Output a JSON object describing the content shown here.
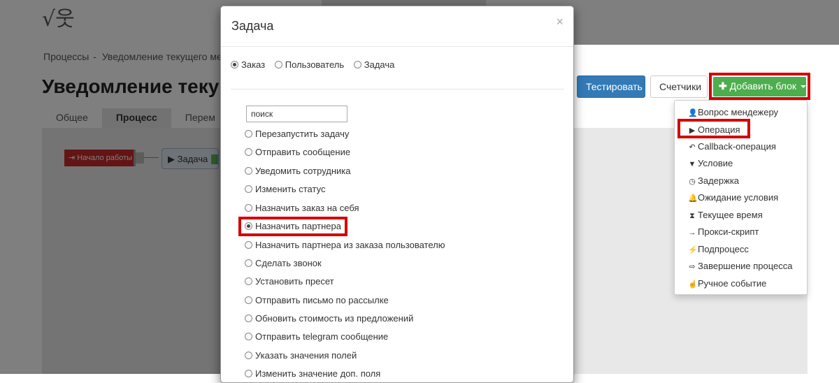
{
  "logo": {
    "text": "√웃"
  },
  "breadcrumb": {
    "root": "Процессы",
    "sep": "-",
    "current": "Уведомление текущего менед"
  },
  "page": {
    "title": "Уведомление текущ"
  },
  "tabs": [
    {
      "label": "Общее"
    },
    {
      "label": "Процесс"
    },
    {
      "label": "Перем"
    }
  ],
  "flow": {
    "start": "Начало работы",
    "task": "Задача"
  },
  "toolbar": {
    "test_label": "Тестировать",
    "counters_label": "Счетчики",
    "add_block_label": "Добавить блок"
  },
  "dropdown": {
    "items": [
      {
        "label": "Вопрос мендежеру",
        "icon": "user-icon"
      },
      {
        "label": "Операция",
        "icon": "play-icon"
      },
      {
        "label": "Callback-операция",
        "icon": "reply-icon"
      },
      {
        "label": "Условие",
        "icon": "filter-icon"
      },
      {
        "label": "Задержка",
        "icon": "clock-icon"
      },
      {
        "label": "Ожидание условия",
        "icon": "bell-icon"
      },
      {
        "label": "Текущее время",
        "icon": "hourglass-icon"
      },
      {
        "label": "Прокси-скрипт",
        "icon": "arrow-right-icon"
      },
      {
        "label": "Подпроцесс",
        "icon": "plug-icon"
      },
      {
        "label": "Завершение процесса",
        "icon": "sign-out-icon"
      },
      {
        "label": "Ручное событие",
        "icon": "hand-pointer-icon"
      }
    ]
  },
  "modal": {
    "title": "Задача",
    "close": "×",
    "types": [
      {
        "label": "Заказ",
        "checked": true
      },
      {
        "label": "Пользователь",
        "checked": false
      },
      {
        "label": "Задача",
        "checked": false
      }
    ],
    "search_value": "поиск",
    "operations": [
      {
        "label": "Перезапустить задачу",
        "checked": false
      },
      {
        "label": "Отправить сообщение",
        "checked": false
      },
      {
        "label": "Уведомить сотрудника",
        "checked": false
      },
      {
        "label": "Изменить статус",
        "checked": false
      },
      {
        "label": "Назначить заказ на себя",
        "checked": false
      },
      {
        "label": "Назначить партнера",
        "checked": true
      },
      {
        "label": "Назначить партнера из заказа пользователю",
        "checked": false
      },
      {
        "label": "Сделать звонок",
        "checked": false
      },
      {
        "label": "Установить пресет",
        "checked": false
      },
      {
        "label": "Отправить письмо по рассылке",
        "checked": false
      },
      {
        "label": "Обновить стоимость из предложений",
        "checked": false
      },
      {
        "label": "Отправить telegram сообщение",
        "checked": false
      },
      {
        "label": "Указать значения полей",
        "checked": false
      },
      {
        "label": "Изменить значение доп. поля",
        "checked": false
      }
    ]
  },
  "colors": {
    "primary": "#337ab7",
    "success": "#4cae4c",
    "highlight": "#d50000",
    "danger": "#c62828"
  }
}
